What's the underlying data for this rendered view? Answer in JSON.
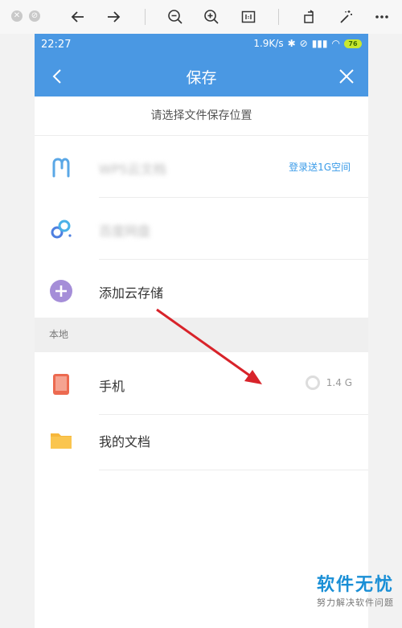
{
  "status": {
    "time": "22:27",
    "speed": "1.9K/s",
    "battery": "76"
  },
  "nav": {
    "title": "保存"
  },
  "hint": "请选择文件保存位置",
  "cloud_items": [
    {
      "label": "WPS云文档",
      "right": "登录送1G空间"
    },
    {
      "label": "百度网盘"
    },
    {
      "label": "添加云存储"
    }
  ],
  "section_local": "本地",
  "local_items": [
    {
      "label": "手机",
      "storage": "1.4 G"
    },
    {
      "label": "我的文档"
    }
  ],
  "watermark": {
    "title": "软件无忧",
    "sub": "努力解决软件问题"
  },
  "colors": {
    "header_blue": "#4a98e3",
    "accent_red": "#d8232a"
  }
}
